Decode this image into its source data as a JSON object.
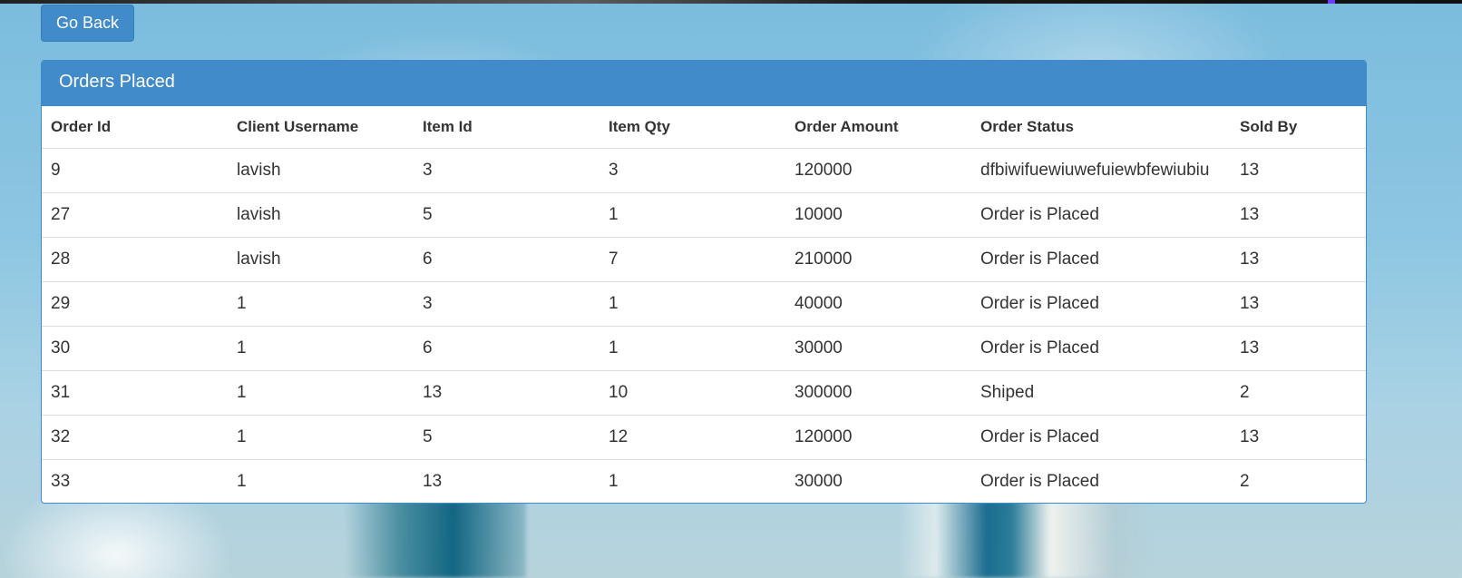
{
  "nav": {
    "go_back_label": "Go Back"
  },
  "panel": {
    "title": "Orders Placed",
    "columns": [
      "Order Id",
      "Client Username",
      "Item Id",
      "Item Qty",
      "Order Amount",
      "Order Status",
      "Sold By"
    ],
    "rows": [
      [
        "9",
        "lavish",
        "3",
        "3",
        "120000",
        "dfbiwifuewiuwefuiewbfewiubiu",
        "13"
      ],
      [
        "27",
        "lavish",
        "5",
        "1",
        "10000",
        "Order is Placed",
        "13"
      ],
      [
        "28",
        "lavish",
        "6",
        "7",
        "210000",
        "Order is Placed",
        "13"
      ],
      [
        "29",
        "1",
        "3",
        "1",
        "40000",
        "Order is Placed",
        "13"
      ],
      [
        "30",
        "1",
        "6",
        "1",
        "30000",
        "Order is Placed",
        "13"
      ],
      [
        "31",
        "1",
        "13",
        "10",
        "300000",
        "Shiped",
        "2"
      ],
      [
        "32",
        "1",
        "5",
        "12",
        "120000",
        "Order is Placed",
        "13"
      ],
      [
        "33",
        "1",
        "13",
        "1",
        "30000",
        "Order is Placed",
        "2"
      ]
    ]
  },
  "colors": {
    "primary": "#428bca",
    "text": "#333333",
    "row_border": "#dddddd"
  }
}
